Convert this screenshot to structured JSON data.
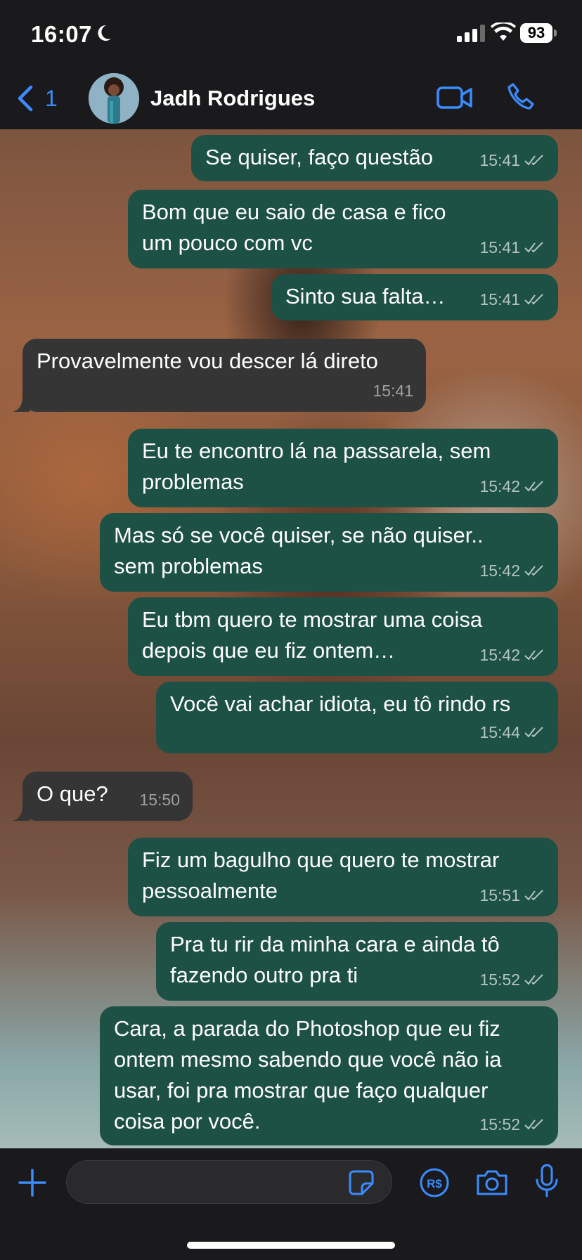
{
  "status_bar": {
    "time": "16:07",
    "battery": "93"
  },
  "header": {
    "back_count": "1",
    "contact_name": "Jadh Rodrigues"
  },
  "messages": [
    {
      "dir": "out",
      "text": "Se quiser, faço questão",
      "time": "15:41"
    },
    {
      "dir": "out",
      "text": "Bom que eu saio de casa e fico um pouco com vc",
      "time": "15:41"
    },
    {
      "dir": "out",
      "text": "Sinto sua falta…",
      "time": "15:41"
    },
    {
      "dir": "in",
      "text": "Provavelmente vou descer lá direto",
      "time": "15:41"
    },
    {
      "dir": "out",
      "text": "Eu te encontro lá na passarela, sem problemas",
      "time": "15:42"
    },
    {
      "dir": "out",
      "text": "Mas só se você quiser, se não quiser.. sem problemas",
      "time": "15:42"
    },
    {
      "dir": "out",
      "text": "Eu tbm quero te mostrar uma coisa depois que eu fiz ontem…",
      "time": "15:42"
    },
    {
      "dir": "out",
      "text": "Você vai achar idiota, eu tô rindo rs",
      "time": "15:44"
    },
    {
      "dir": "in",
      "text": "O que?",
      "time": "15:50"
    },
    {
      "dir": "out",
      "text": "Fiz um bagulho que quero te mostrar pessoalmente",
      "time": "15:51"
    },
    {
      "dir": "out",
      "text": "Pra tu rir da minha cara e ainda tô fazendo outro pra ti",
      "time": "15:52"
    },
    {
      "dir": "out",
      "text": "Cara, a parada do Photoshop que eu fiz ontem mesmo sabendo que você não ia usar, foi pra mostrar que faço qualquer coisa por você.",
      "time": "15:52"
    }
  ],
  "composer": {
    "value": ""
  },
  "icons": {
    "back": "chevron-left-icon",
    "video": "video-camera-icon",
    "call": "phone-icon",
    "plus": "plus-icon",
    "sticker": "sticker-icon",
    "pix": "pix-payment-icon",
    "camera": "camera-icon",
    "mic": "microphone-icon",
    "read": "double-check-icon"
  },
  "colors": {
    "accent": "#3b8cff",
    "outgoing_bubble": "#1d5145",
    "incoming_bubble": "#353535"
  }
}
